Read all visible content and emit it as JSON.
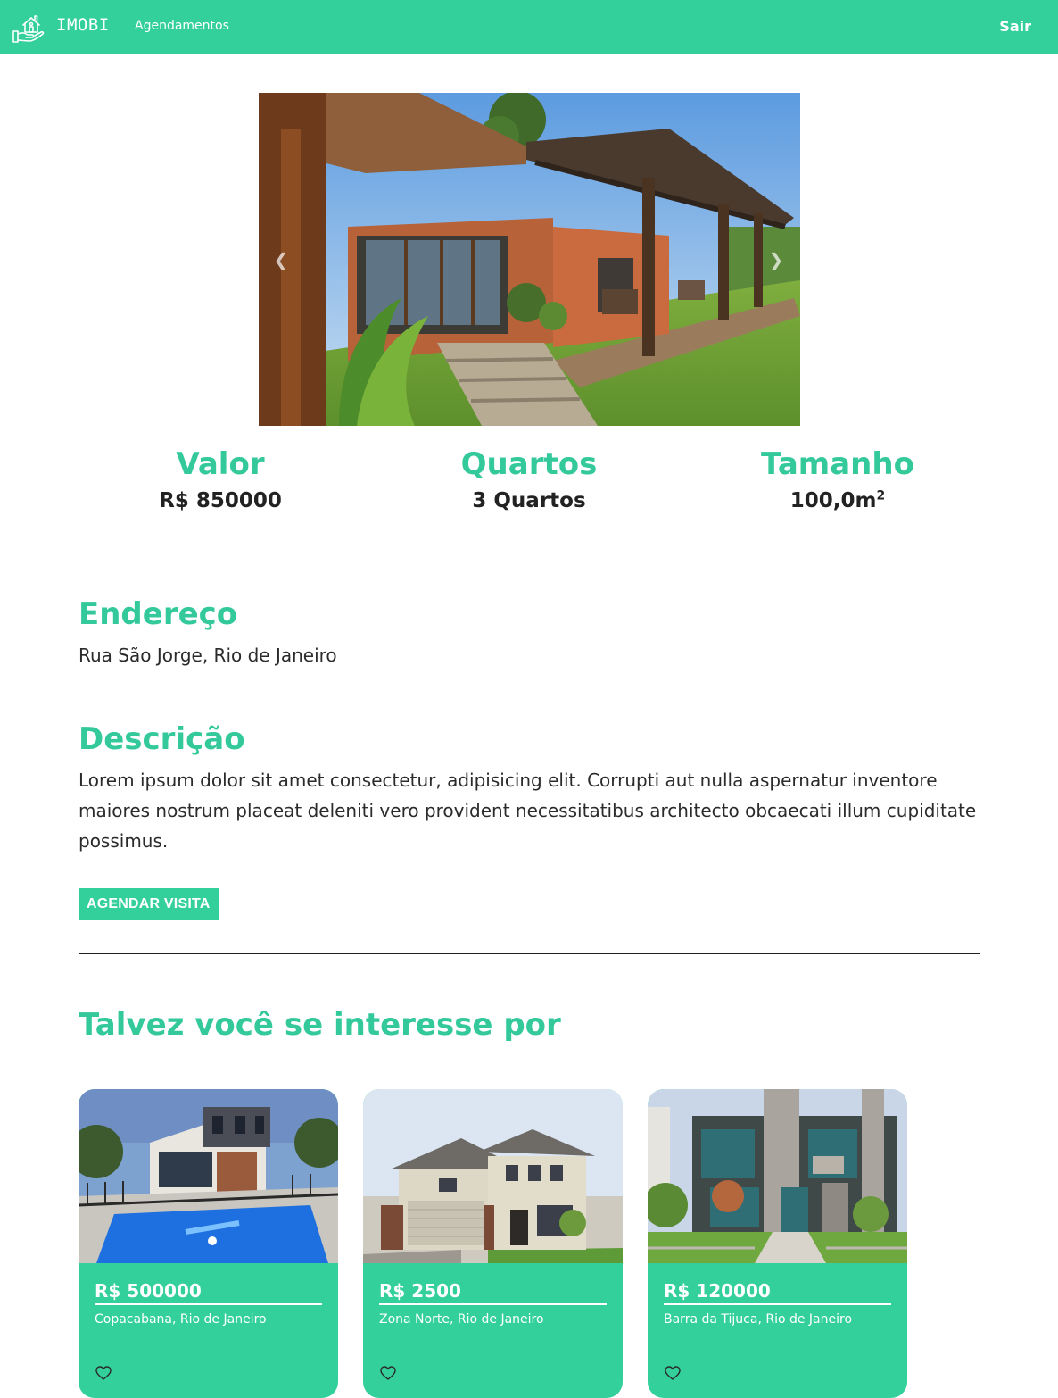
{
  "navbar": {
    "brand": "IMOBI",
    "links": [
      "Agendamentos"
    ],
    "logout": "Sair",
    "colors": {
      "background": "#33d09c",
      "text": "#ffffff"
    },
    "logo_icon": "house-in-hand-icon"
  },
  "carousel": {
    "prev_icon": "chevron-left-icon",
    "next_icon": "chevron-right-icon"
  },
  "stats": [
    {
      "label": "Valor",
      "value": "R$ 850000"
    },
    {
      "label": "Quartos",
      "value": "3 Quartos"
    },
    {
      "label": "Tamanho",
      "value": "100,0m",
      "sup": "2"
    }
  ],
  "address": {
    "title": "Endereço",
    "text": "Rua São Jorge, Rio de Janeiro"
  },
  "description": {
    "title": "Descrição",
    "text": "Lorem ipsum dolor sit amet consectetur, adipisicing elit. Corrupti aut nulla aspernatur inventore maiores nostrum placeat deleniti vero provident necessitatibus architecto obcaecati illum cupiditate possimus."
  },
  "cta": {
    "label": "AGENDAR VISITA"
  },
  "related": {
    "title": "Talvez você se interesse por",
    "cards": [
      {
        "price": "R$ 500000",
        "location": "Copacabana, Rio de Janeiro",
        "fav_icon": "heart-icon"
      },
      {
        "price": "R$ 2500",
        "location": "Zona Norte, Rio de Janeiro",
        "fav_icon": "heart-icon"
      },
      {
        "price": "R$ 120000",
        "location": "Barra da Tijuca, Rio de Janeiro",
        "fav_icon": "heart-icon"
      }
    ]
  },
  "theme": {
    "accent": "#33d09c",
    "heading": "#33c99a",
    "text": "#222222"
  }
}
